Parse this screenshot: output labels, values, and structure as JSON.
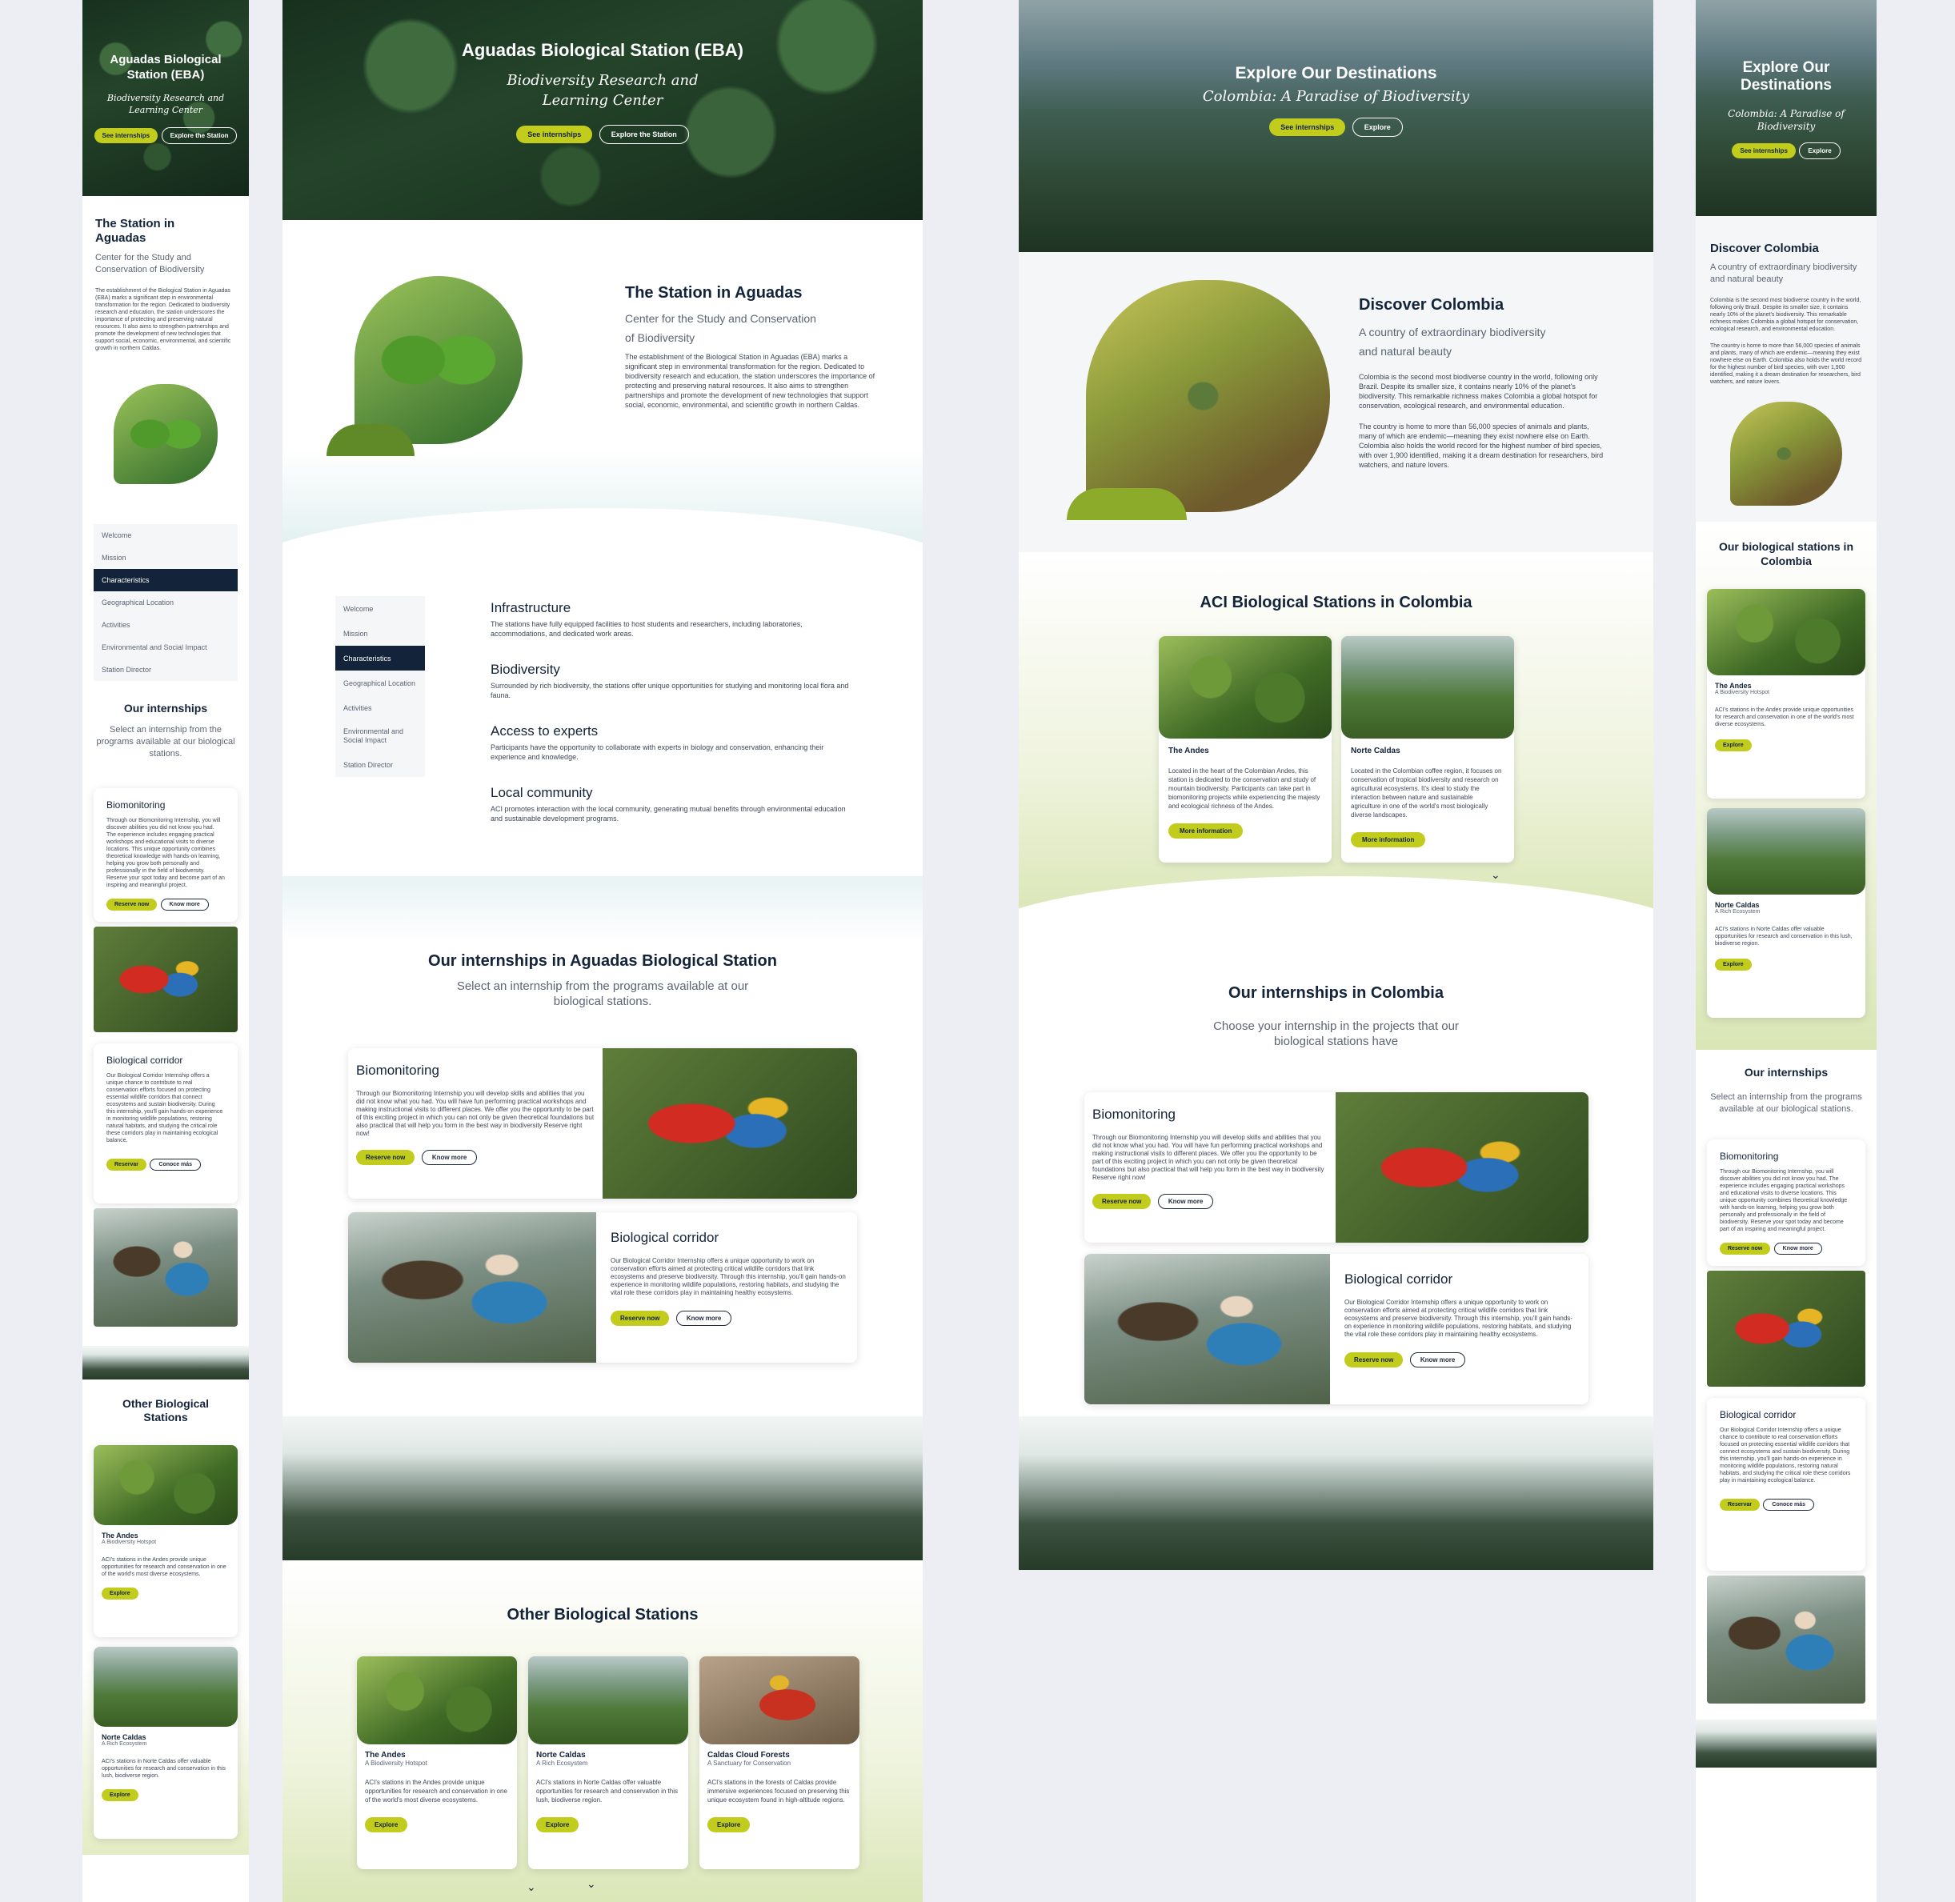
{
  "eba": {
    "title": "Aguadas Biological Station (EBA)",
    "subtitle": "Biodiversity Research and Learning Center",
    "btn_internships": "See internships",
    "btn_explore": "Explore the Station",
    "station_title": "The Station in Aguadas",
    "station_subtitle": "Center for the Study and Conservation of Biodiversity",
    "station_text": "The establishment of the Biological Station in Aguadas (EBA) marks a significant step in environmental transformation for the region. Dedicated to biodiversity research and education, the station underscores the importance of protecting and preserving natural resources. It also aims to strengthen partnerships and promote the development of new technologies that support social, economic, environmental, and scientific growth in northern Caldas.",
    "menu": [
      "Welcome",
      "Mission",
      "Characteristics",
      "Geographical Location",
      "Activities",
      "Environmental and Social Impact",
      "Station Director"
    ],
    "features": [
      {
        "title": "Infrastructure",
        "text": "The stations have fully equipped facilities to host students and researchers, including laboratories, accommodations, and dedicated work areas."
      },
      {
        "title": "Biodiversity",
        "text": "Surrounded by rich biodiversity, the stations offer unique opportunities for studying and monitoring local flora and fauna."
      },
      {
        "title": "Access to experts",
        "text": "Participants have the opportunity to collaborate with experts in biology and conservation, enhancing their experience and knowledge."
      },
      {
        "title": "Local community",
        "text": "ACI promotes interaction with the local community, generating mutual benefits through environmental education and sustainable development programs."
      }
    ],
    "internships_title": "Our internships in Aguadas Biological Station",
    "internships_sub": "Select an internship from the programs available at our  biological stations.",
    "biomonitoring_title": "Biomonitoring",
    "biomonitoring_text": "Through our Biomonitoring Internship you will develop skills and abilities that you did not know what you had. You will have fun performing practical workshops and making instructional visits to different places. We offer you the opportunity to be part of this exciting project in which you can not only be given theoretical foundations but also practical that will help you form in the best way in biodiversity Reserve right now!",
    "corridor_title": "Biological corridor",
    "corridor_text": "Our Biological Corridor Internship offers a unique opportunity to work on conservation efforts aimed at protecting critical wildlife corridors that link ecosystems and preserve biodiversity. Through this internship, you'll gain hands-on experience in monitoring wildlife populations, restoring habitats, and studying the vital role these corridors play in maintaining healthy ecosystems.",
    "reserve": "Reserve now",
    "know_more": "Know more",
    "other_title": "Other Biological Stations",
    "stations": [
      {
        "name": "The Andes",
        "tag": "A Biodiversity Hotspot",
        "text": "ACI's stations in the Andes provide unique opportunities for research and conservation in one of the world's most diverse ecosystems.",
        "btn": "Explore"
      },
      {
        "name": "Norte Caldas",
        "tag": "A Rich Ecosystem",
        "text": "ACI's stations in Norte Caldas offer valuable opportunities for research and conservation in this lush, biodiverse region.",
        "btn": "Explore"
      },
      {
        "name": "Caldas Cloud Forests",
        "tag": "A Sanctuary for Conservation",
        "text": "ACI's stations in the forests of Caldas provide immersive experiences focused on preserving this unique ecosystem found in high-altitude regions.",
        "btn": "Explore"
      }
    ]
  },
  "mobile1": {
    "station_title": "The Station in Aguadas",
    "station_subtitle": "Center for the Study and Conservation of Biodiversity",
    "internships_title": "Our internships",
    "internships_sub": "Select an internship from the programs available at our biological stations.",
    "biomonitoring_text": "Through our Biomonitoring Internship, you will discover abilities you did not know you had. The experience includes engaging practical workshops and educational visits to diverse locations. This unique opportunity combines theoretical knowledge with hands-on learning, helping you grow both personally and professionally in the field of biodiversity. Reserve your spot today and become part of an inspiring and meaningful project.",
    "corridor_text": "Our Biological Corridor Internship offers a unique chance to contribute to real conservation efforts focused on protecting essential wildlife corridors that connect ecosystems and sustain biodiversity. During this internship, you'll gain hands-on experience in monitoring wildlife populations, restoring natural habitats, and studying the critical role these corridors play in maintaining ecological balance.",
    "reserve_es": "Reservar",
    "know_more_es": "Conoce más",
    "other_title": "Other Biological Stations"
  },
  "colombia": {
    "title": "Explore Our Destinations",
    "subtitle": "Colombia: A Paradise of Biodiversity",
    "btn_internships": "See internships",
    "btn_explore": "Explore",
    "discover_title": "Discover Colombia",
    "discover_subtitle": "A country of extraordinary biodiversity and natural beauty",
    "discover_p1": "Colombia is the second most biodiverse country in the world, following only Brazil. Despite its smaller size, it contains nearly 10% of the planet's biodiversity. This remarkable richness makes Colombia a global hotspot for conservation, ecological research, and environmental education.",
    "discover_p2": "The country is home to more than 56,000 species of animals and plants, many of which are endemic—meaning they exist nowhere else on Earth. Colombia also holds the world record for the highest number of bird species, with over 1,900 identified, making it a dream destination for researchers, bird watchers, and nature lovers.",
    "aci_title": "ACI Biological Stations in Colombia",
    "aci_stations": [
      {
        "name": "The Andes",
        "text": "Located in the heart of the Colombian Andes, this station is dedicated to the conservation and study of mountain biodiversity. Participants can take part in biomonitoring projects while experiencing the majesty and ecological richness of the Andes.",
        "btn": "More information"
      },
      {
        "name": "Norte Caldas",
        "text": "Located in the Colombian coffee region, it focuses on conservation of tropical biodiversity and research on agricultural ecosystems. It's ideal to study the interaction between nature and sustainable agriculture in one of the world's most biologically diverse landscapes.",
        "btn": "More information"
      }
    ],
    "internships_title": "Our internships in Colombia",
    "internships_sub": "Choose your internship in the projects that our biological stations have",
    "biomonitoring_title": "Biomonitoring",
    "corridor_title": "Biological corridor"
  },
  "mobile2": {
    "title": "Explore Our Destinations",
    "subtitle": "Colombia: A Paradise of Biodiversity",
    "discover_title": "Discover Colombia",
    "discover_subtitle": "A country of extraordinary biodiversity and natural beauty",
    "stations_title": "Our biological stations in Colombia",
    "internships_title": "Our internships",
    "internships_sub": "Select an internship from the programs available at our biological stations."
  }
}
